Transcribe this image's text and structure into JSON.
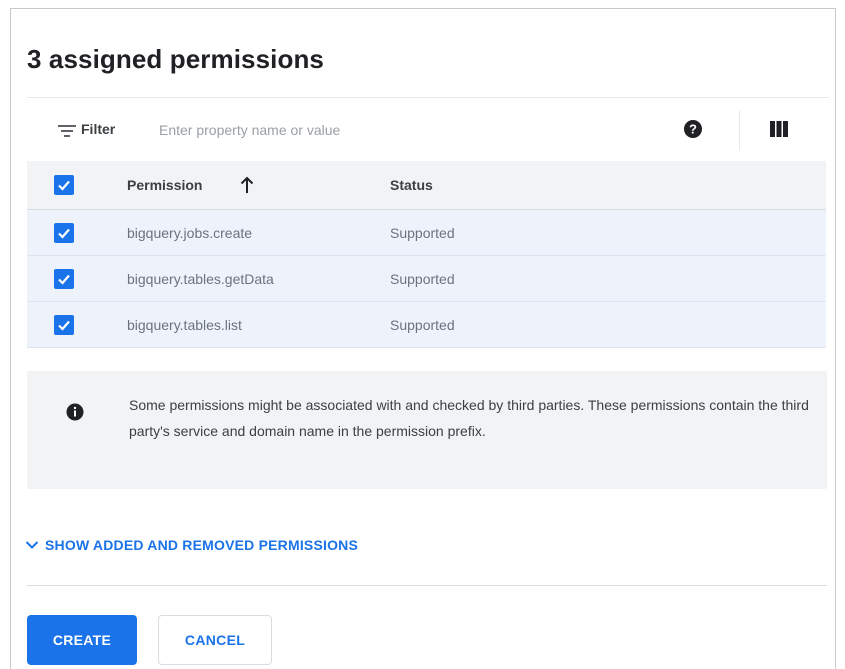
{
  "dialog": {
    "title": "3 assigned permissions"
  },
  "toolbar": {
    "filter_label": "Filter",
    "filter_placeholder": "Enter property name or value",
    "filter_value": "",
    "help_icon": "help-circle-icon",
    "columns_icon": "column-display-icon"
  },
  "table": {
    "headers": {
      "permission": "Permission",
      "status": "Status"
    },
    "sort": {
      "column": "Permission",
      "direction": "ascending"
    },
    "select_all_checked": true,
    "rows": [
      {
        "permission": "bigquery.jobs.create",
        "status": "Supported",
        "checked": true
      },
      {
        "permission": "bigquery.tables.getData",
        "status": "Supported",
        "checked": true
      },
      {
        "permission": "bigquery.tables.list",
        "status": "Supported",
        "checked": true
      }
    ]
  },
  "info": {
    "icon": "info-icon",
    "text": "Some permissions might be associated with and checked by third parties. These permissions contain the third party's service and domain name in the permission prefix."
  },
  "links": {
    "show_added_removed": "SHOW ADDED AND REMOVED PERMISSIONS"
  },
  "actions": {
    "create_label": "CREATE",
    "cancel_label": "CANCEL"
  },
  "colors": {
    "accent": "#1a73e8",
    "row_selected": "#eef3fb",
    "header_bg": "#f1f3f4"
  }
}
